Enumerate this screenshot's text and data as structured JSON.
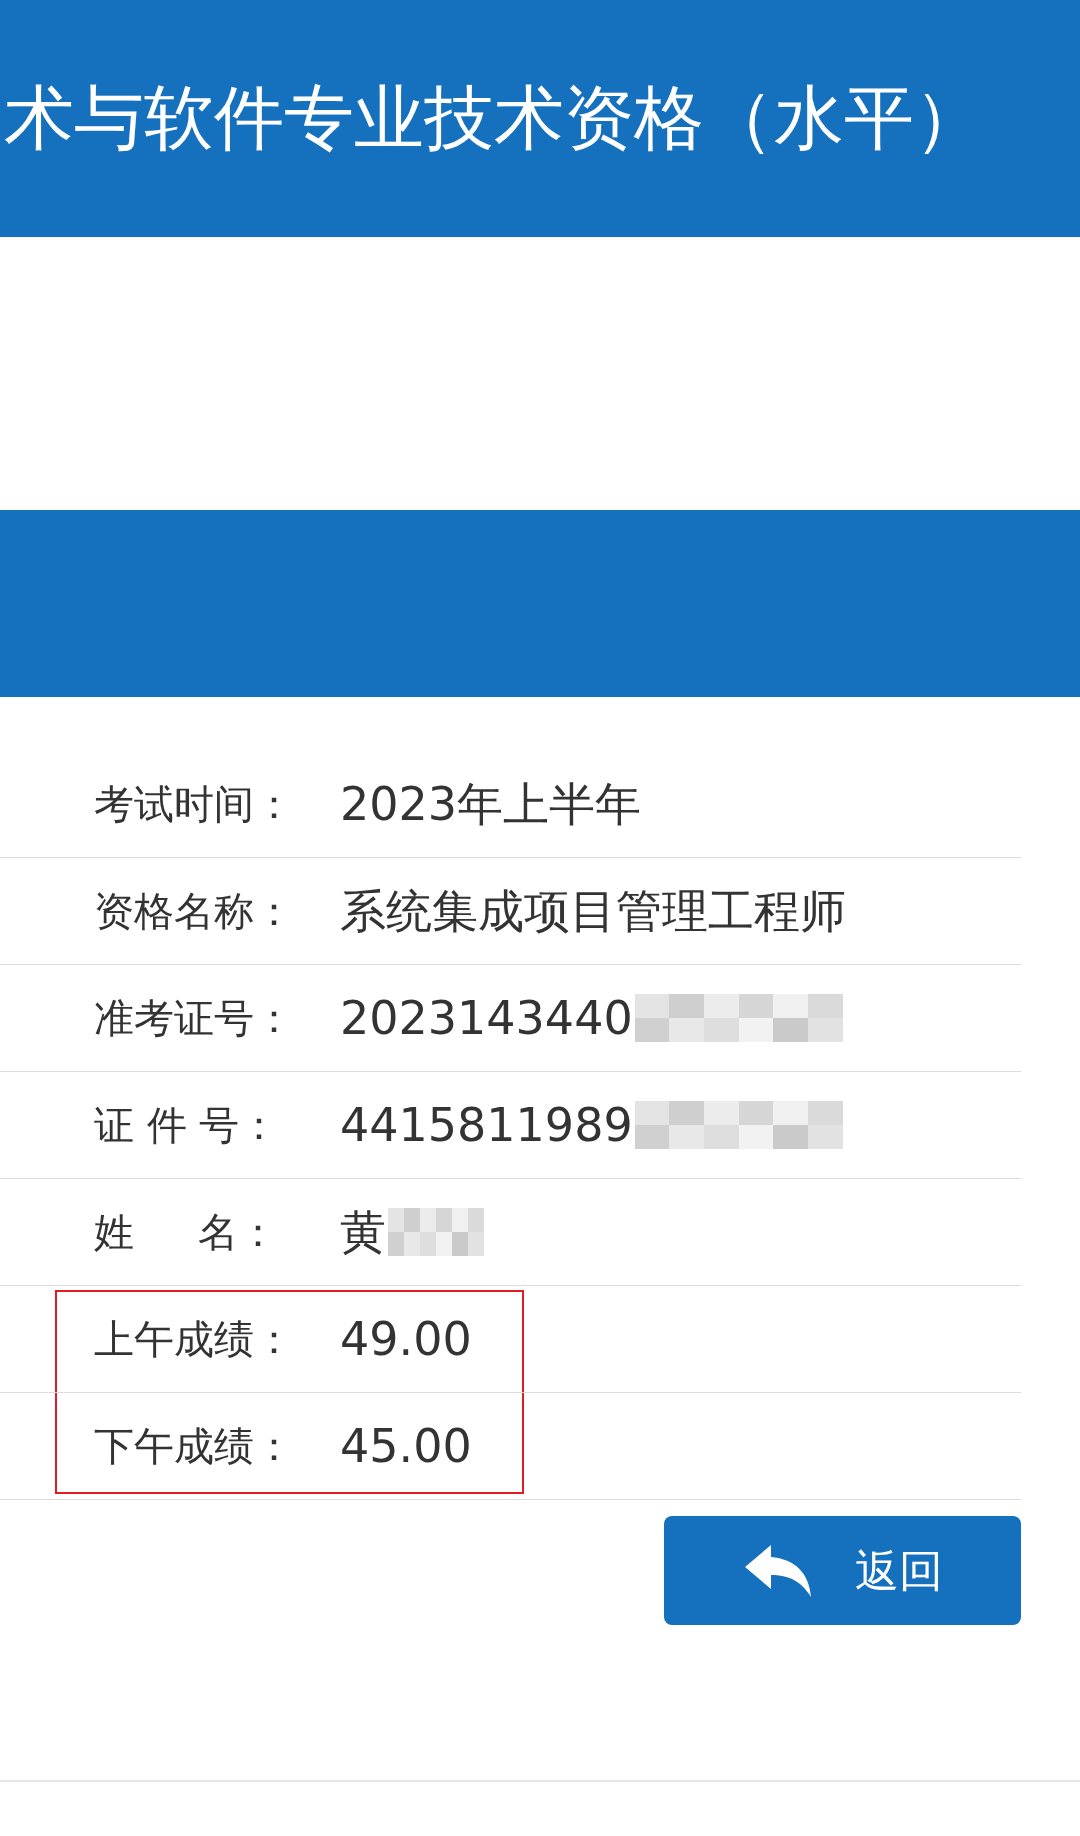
{
  "header": {
    "title": "术与软件专业技术资格（水平）"
  },
  "rows": [
    {
      "label": "考试时间：",
      "value": "2023年上半年",
      "redacted": false,
      "highlighted": false
    },
    {
      "label": "资格名称：",
      "value": "系统集成项目管理工程师",
      "redacted": false,
      "highlighted": false
    },
    {
      "label": "准考证号：",
      "value": "2023143440",
      "redacted": true,
      "highlighted": false
    },
    {
      "label": "证 件 号：",
      "value": "4415811989",
      "redacted": true,
      "highlighted": false
    },
    {
      "label": "姓     名：",
      "value": "黄",
      "redacted": true,
      "highlighted": false
    },
    {
      "label": "上午成绩：",
      "value": "49.00",
      "redacted": false,
      "highlighted": true
    },
    {
      "label": "下午成绩：",
      "value": "45.00",
      "redacted": false,
      "highlighted": true
    }
  ],
  "back_button": {
    "label": "返回"
  }
}
